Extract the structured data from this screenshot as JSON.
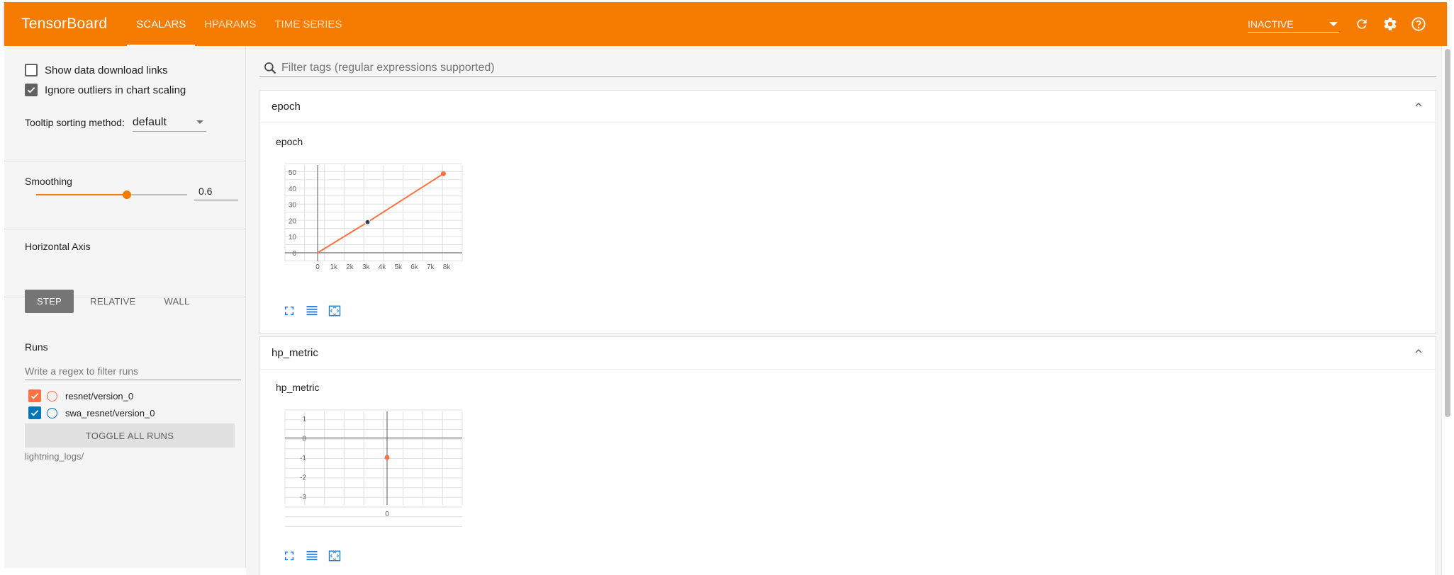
{
  "header": {
    "brand": "TensorBoard",
    "tabs": [
      {
        "label": "SCALARS",
        "active": true
      },
      {
        "label": "HPARAMS",
        "active": false
      },
      {
        "label": "TIME SERIES",
        "active": false
      }
    ],
    "status": "INACTIVE",
    "icons": [
      "refresh-icon",
      "gear-icon",
      "help-icon"
    ]
  },
  "sidebar": {
    "show_download_label": "Show data download links",
    "show_download_checked": false,
    "ignore_outliers_label": "Ignore outliers in chart scaling",
    "ignore_outliers_checked": true,
    "tooltip_label": "Tooltip sorting method:",
    "tooltip_value": "default",
    "smoothing_label": "Smoothing",
    "smoothing_value": "0.6",
    "smoothing_fraction": 0.6,
    "axis_label": "Horizontal Axis",
    "axis_options": [
      "STEP",
      "RELATIVE",
      "WALL"
    ],
    "axis_selected": "STEP",
    "runs_label": "Runs",
    "runs_filter_placeholder": "Write a regex to filter runs",
    "runs": [
      {
        "name": "resnet/version_0",
        "color": "#ff7043",
        "checked": true
      },
      {
        "name": "swa_resnet/version_0",
        "color": "#0077bb",
        "checked": true
      }
    ],
    "toggle_all_label": "TOGGLE ALL RUNS",
    "logdir": "lightning_logs/"
  },
  "main": {
    "search_placeholder": "Filter tags (regular expressions supported)"
  },
  "colors": {
    "accent": "#f57c00",
    "series": "#ff7043",
    "tool_blue": "#1976d2"
  },
  "chart_data": [
    {
      "type": "line",
      "card_title": "epoch",
      "title": "epoch",
      "x_ticks": [
        "0",
        "1k",
        "2k",
        "3k",
        "4k",
        "5k",
        "6k",
        "7k",
        "8k"
      ],
      "y_ticks": [
        "50",
        "40",
        "30",
        "20",
        "10",
        "0"
      ],
      "xlim": [
        0,
        8000
      ],
      "ylim": [
        0,
        50
      ],
      "series": [
        {
          "points": [
            [
              0,
              0
            ],
            [
              3100,
              19
            ],
            [
              7800,
              49
            ]
          ]
        }
      ],
      "highlight_point": [
        3100,
        19
      ],
      "grid": true
    },
    {
      "type": "scatter",
      "card_title": "hp_metric",
      "title": "hp_metric",
      "x_ticks": [
        "0"
      ],
      "y_ticks": [
        "1",
        "0",
        "-1",
        "-2",
        "-3"
      ],
      "xlim": [
        0,
        0
      ],
      "ylim": [
        -3,
        1
      ],
      "series": [
        {
          "points": [
            [
              0,
              -1
            ]
          ]
        }
      ],
      "grid": true
    }
  ]
}
